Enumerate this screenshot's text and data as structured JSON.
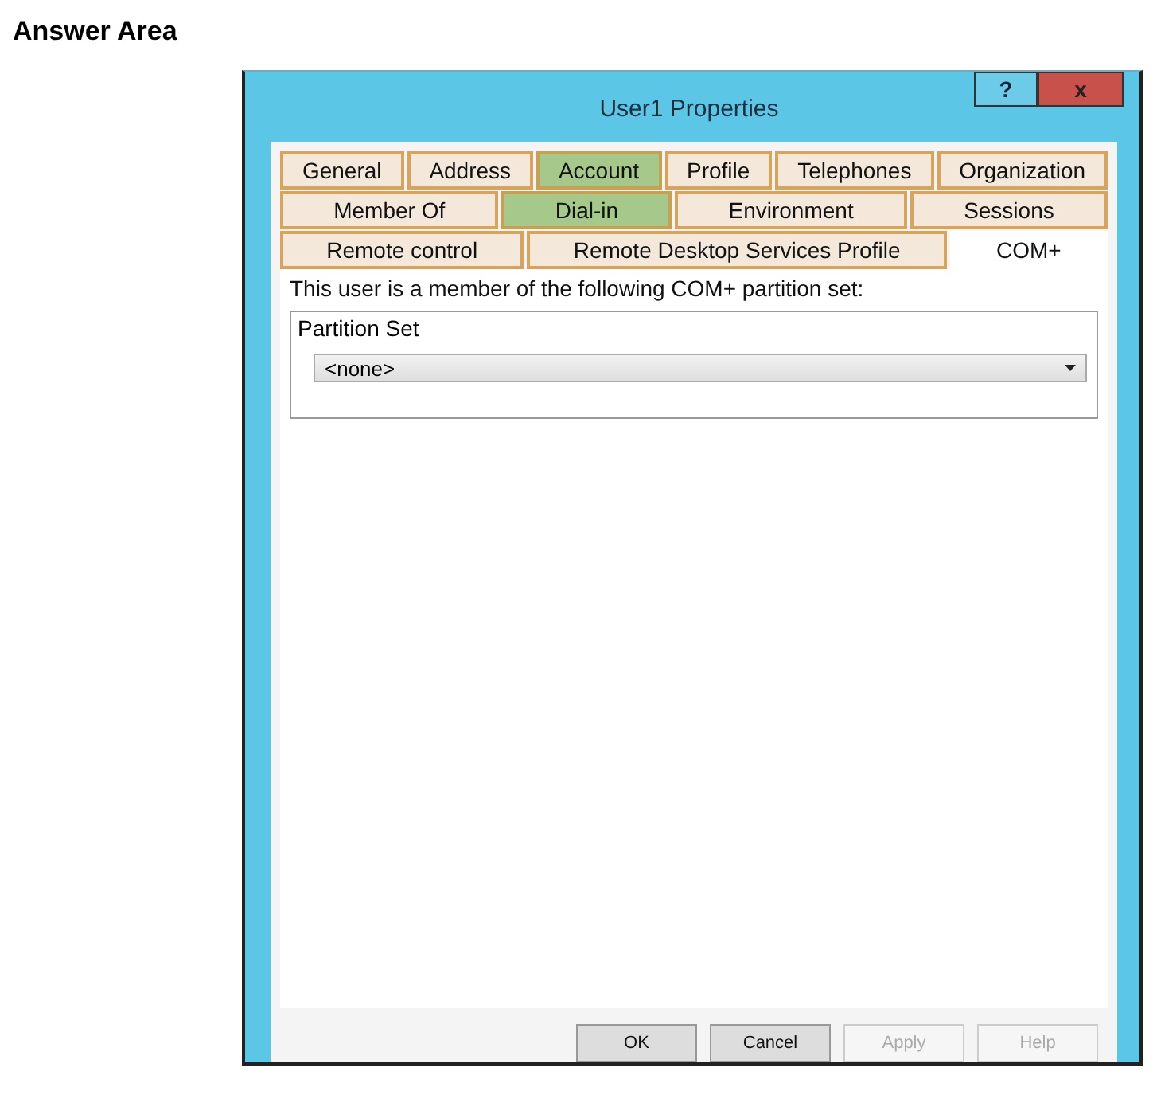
{
  "heading": "Answer Area",
  "window": {
    "title": "User1 Properties",
    "title_buttons": [
      {
        "kind": "help",
        "label": "?"
      },
      {
        "kind": "close",
        "label": "x"
      }
    ]
  },
  "tab_rows": [
    [
      {
        "label": "General",
        "selected": false,
        "highlighted": false
      },
      {
        "label": "Address",
        "selected": false,
        "highlighted": false
      },
      {
        "label": "Account",
        "selected": false,
        "highlighted": true
      },
      {
        "label": "Profile",
        "selected": false,
        "highlighted": false
      },
      {
        "label": "Telephones",
        "selected": false,
        "highlighted": false
      },
      {
        "label": "Organization",
        "selected": false,
        "highlighted": false
      }
    ],
    [
      {
        "label": "Member Of",
        "selected": false,
        "highlighted": false
      },
      {
        "label": "Dial-in",
        "selected": false,
        "highlighted": true
      },
      {
        "label": "Environment",
        "selected": false,
        "highlighted": false
      },
      {
        "label": "Sessions",
        "selected": false,
        "highlighted": false
      }
    ],
    [
      {
        "label": "Remote control",
        "selected": false,
        "highlighted": false
      },
      {
        "label": "Remote Desktop Services Profile",
        "selected": false,
        "highlighted": false
      },
      {
        "label": "COM+",
        "selected": true,
        "highlighted": false
      }
    ]
  ],
  "description": "This user is a member of the following COM+ partition set:",
  "group": {
    "label": "Partition Set",
    "dropdown": {
      "value": "<none>"
    }
  },
  "buttons": [
    {
      "label": "OK",
      "disabled": false
    },
    {
      "label": "Cancel",
      "disabled": false
    },
    {
      "label": "Apply",
      "disabled": true
    },
    {
      "label": "Help",
      "disabled": true
    }
  ]
}
